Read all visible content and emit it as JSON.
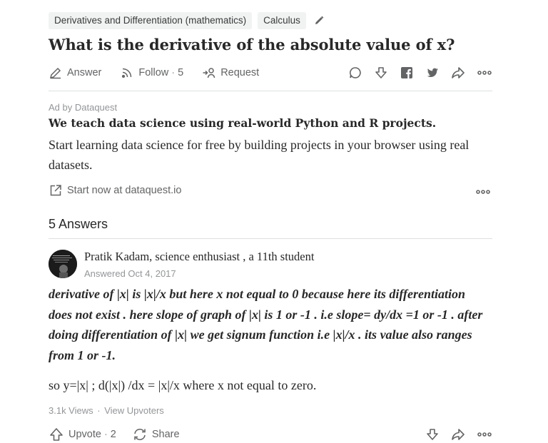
{
  "question": {
    "topics": [
      "Derivatives and Differentiation (mathematics)",
      "Calculus"
    ],
    "title": "What is the derivative of the absolute value of x?"
  },
  "actions": {
    "answer_label": "Answer",
    "follow_label": "Follow",
    "follow_count": "5",
    "request_label": "Request"
  },
  "ad": {
    "label": "Ad by Dataquest",
    "headline": "We teach data science using real-world Python and R projects.",
    "body": "Start learning data science for free by building projects in your browser using real datasets.",
    "link_text": "Start now at dataquest.io"
  },
  "answers": {
    "count_label": "5 Answers"
  },
  "answer": {
    "author": "Pratik Kadam, science enthusiast , a 11th student",
    "answered_date": "Answered Oct 4, 2017",
    "body_bold": "derivative of |x| is |x|/x but here x not equal to 0 because here its differentiation does not exist . here slope of graph of |x| is 1 or -1 . i.e slope= dy/dx =1 or -1 . after doing differentiation of |x| we get signum function i.e |x|/x . its value also ranges from 1 or -1.",
    "body_plain": "so y=|x| ; d(|x|) /dx = |x|/x where x not equal to zero.",
    "views": "3.1k Views",
    "view_upvoters": "View Upvoters",
    "upvote_label": "Upvote",
    "upvote_count": "2",
    "share_label": "Share"
  },
  "colors": {
    "text": "#282829",
    "muted": "#636466",
    "light": "#939598",
    "divider": "#dee0e1",
    "topic_bg": "#f1f2f2"
  },
  "icons": [
    "pencil-icon",
    "answer-icon",
    "follow-icon",
    "request-icon",
    "comment-icon",
    "downvote-icon",
    "facebook-icon",
    "twitter-icon",
    "share-icon",
    "more-icon",
    "external-link-icon",
    "upvote-icon",
    "reshare-icon"
  ]
}
